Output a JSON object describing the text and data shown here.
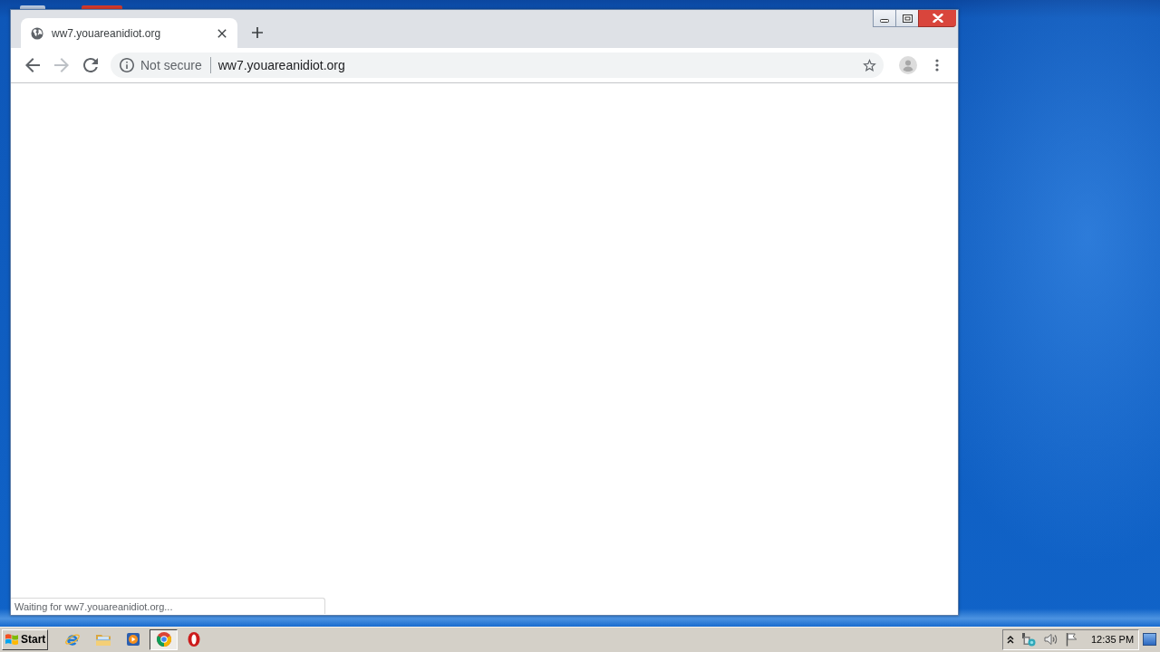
{
  "browser": {
    "tabs": [
      {
        "title": "ww7.youareanidiot.org",
        "selected": true
      }
    ],
    "toolbar": {
      "nav_buttons": [
        {
          "kind": "back",
          "disabled": false
        },
        {
          "kind": "forward",
          "disabled": true
        },
        {
          "kind": "reload",
          "disabled": false
        }
      ],
      "omnibox": {
        "security_label": "Not secure",
        "url": "ww7.youareanidiot.org"
      }
    },
    "status_bubble": "Waiting for ww7.youareanidiot.org..."
  },
  "taskbar": {
    "start_label": "Start",
    "apps": [
      {
        "kind": "e-logo",
        "selected": false
      },
      {
        "kind": "folders",
        "selected": false
      },
      {
        "kind": "play-tile",
        "selected": false
      },
      {
        "kind": "round-logo",
        "selected": true
      },
      {
        "kind": "o-logo",
        "selected": false
      }
    ],
    "tray_icons": [
      {
        "kind": "show-hidden"
      },
      {
        "kind": "network"
      },
      {
        "kind": "volume"
      },
      {
        "kind": "flag"
      }
    ],
    "clock": "12:35 PM"
  }
}
